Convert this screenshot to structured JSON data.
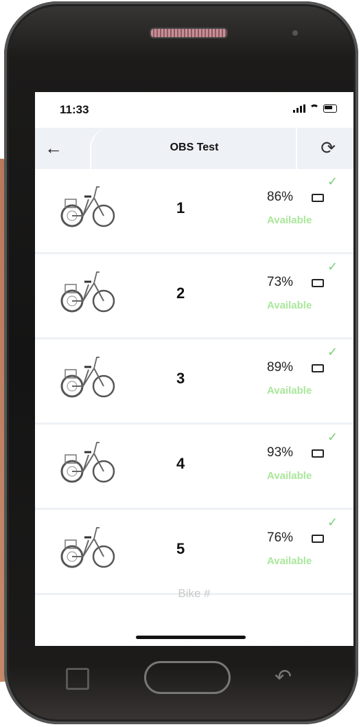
{
  "status_bar": {
    "time": "11:33"
  },
  "header": {
    "title": "OBS Test",
    "back_icon": "arrow-left-icon",
    "refresh_icon": "refresh-icon"
  },
  "bikes": [
    {
      "number": "1",
      "battery": "86%",
      "status": "Available"
    },
    {
      "number": "2",
      "battery": "73%",
      "status": "Available"
    },
    {
      "number": "3",
      "battery": "89%",
      "status": "Available"
    },
    {
      "number": "4",
      "battery": "93%",
      "status": "Available"
    },
    {
      "number": "5",
      "battery": "76%",
      "status": "Available"
    }
  ],
  "column_label": "Bike #",
  "colors": {
    "available": "#a9e79a",
    "check": "#7dcf7d",
    "header_bg": "#eef1f5"
  }
}
